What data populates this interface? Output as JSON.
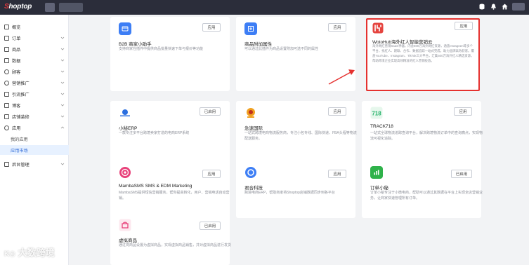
{
  "app": {
    "logo_prefix": "S",
    "logo_rest": "hoptop"
  },
  "sidebar": {
    "items": [
      {
        "label": "概览",
        "has_chevron": false
      },
      {
        "label": "订单",
        "has_chevron": true
      },
      {
        "label": "商品",
        "has_chevron": true
      },
      {
        "label": "数据",
        "has_chevron": true
      },
      {
        "label": "顾客",
        "has_chevron": true
      },
      {
        "label": "营销推广",
        "has_chevron": true
      },
      {
        "label": "引流推广",
        "has_chevron": true
      },
      {
        "label": "博客",
        "has_chevron": true
      },
      {
        "label": "店铺装修",
        "has_chevron": true
      },
      {
        "label": "应用",
        "has_chevron": true
      }
    ],
    "sub_items": [
      {
        "label": "我的应用",
        "active": false
      },
      {
        "label": "应用市场",
        "active": true
      }
    ],
    "bottom_item": {
      "label": "后台管理"
    }
  },
  "cards": [
    {
      "title": "B2B 商家小助手",
      "desc": "支持商家在插件中提供商品批量快速下单与报价等功能",
      "button": "应用",
      "icon": "b2b-icon",
      "color": "#3d7ef5"
    },
    {
      "title": "商品附加属性",
      "desc": "可以通过此插件为商品设置附加可选不同的属性",
      "button": "应用",
      "icon": "attribute-icon",
      "color": "#3d7ef5"
    },
    {
      "title": "WotoHub海外红人智能营销云",
      "desc": "海外网红营销SaaS神器，内含500万海外网红资源，涵盖Instagram等多个平台，找红人、建联、合作、数据追踪一站式完成，助力品牌高效获客。覆盖YouTube、Instagram、TikTok三大平台，汇集500万海外红人精选资源，帮助跨境企业实现高效精准的红人营销投放。",
      "button": "应用",
      "icon": "wotohub-icon",
      "color": "#e5443f"
    },
    {
      "title": "小秘ERP",
      "desc": "一款专注多平台跨境卖家打造的电商ERP系统",
      "button": "已启用",
      "icon": "erp-icon",
      "color": "#2b6fe0"
    },
    {
      "title": "急速国际",
      "desc": "一站式跨境电商物流服务商，专注小包专线、国际快递、FBA头程等物流配送服务。",
      "button": "应用",
      "icon": "shipping-icon",
      "color": "#f0a020"
    },
    {
      "title": "TRACK718",
      "desc": "一站式全球物流追踪查询平台，解决跨境物流订单中的查询痛点，实现物流可视化追踪。",
      "button": "应用",
      "icon": "track718-icon",
      "color": "#26b36b"
    },
    {
      "title": "MambaSMS SMS & EDM Marketing",
      "desc": "MambaSMS提供短信营销服务，帮你提高转化，用户、营销电话自动营销。",
      "button": "应用",
      "icon": "mambasms-icon",
      "color": "#e8417a"
    },
    {
      "title": "君合科技",
      "desc": "跨境电商ERP，帮助商家将Shoptop店铺数据同步到各平台",
      "button": "应用",
      "icon": "junhe-icon",
      "color": "#3d7ef5"
    },
    {
      "title": "订单小秘",
      "desc": "订单小秘专注于小微电商，帮助可以通过其数据在平台上实现全店营销业务，让商家快速管理所有订单。",
      "button": "已启用",
      "icon": "order-helper-icon",
      "color": "#2fb24a"
    },
    {
      "title": "虚拟商品",
      "desc": "通过将商品设置为虚拟商品，实现虚拟商品销售，并对虚拟商品进行发货",
      "button": "已启用",
      "icon": "virtual-goods-icon",
      "color": "#e8417a"
    }
  ],
  "watermark": {
    "text": "大数跨境"
  }
}
